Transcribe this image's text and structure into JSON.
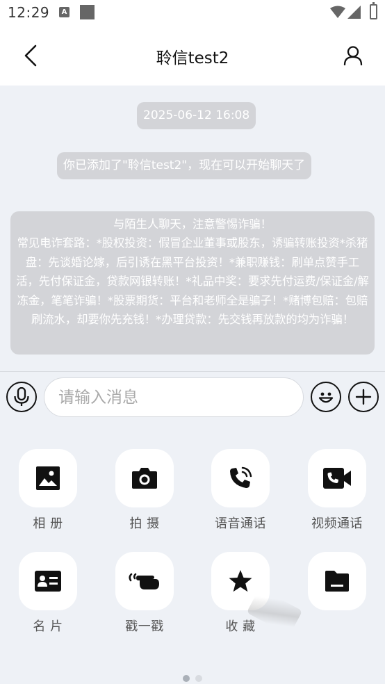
{
  "status_bar": {
    "time": "12:29",
    "notif_letter": "A"
  },
  "header": {
    "title": "聆信test2"
  },
  "chat": {
    "timestamp": "2025-06-12 16:08",
    "system_message": "你已添加了\"聆信test2\"，现在可以开始聊天了",
    "warning": "与陌生人聊天，注意警惕诈骗！\n常见电诈套路：*股权投资：假冒企业董事或股东，诱骗转账投资*杀猪盘：先谈婚论嫁，后引诱在黑平台投资！*兼职赚钱：刷单点赞手工活，先付保证金，贷款网银转账！*礼品中奖：要求先付运费/保证金/解冻金，笔笔诈骗！*股票期货：平台和老师全是骗子！*赌博包赔：包赔刷流水，却要你先充钱！*办理贷款：先交钱再放款的均为诈骗！"
  },
  "input": {
    "placeholder": "请输入消息"
  },
  "panel": {
    "tiles": [
      {
        "label": "相 册",
        "icon": "image-icon"
      },
      {
        "label": "拍 摄",
        "icon": "camera-icon"
      },
      {
        "label": "语音通话",
        "icon": "phone-call-icon"
      },
      {
        "label": "视频通话",
        "icon": "video-call-icon"
      },
      {
        "label": "名 片",
        "icon": "contact-card-icon"
      },
      {
        "label": "戳一戳",
        "icon": "poke-hand-icon"
      },
      {
        "label": "收 藏",
        "icon": "star-icon"
      },
      {
        "label": "",
        "icon": "folder-icon"
      }
    ],
    "page_count": 2,
    "current_page": 1
  }
}
